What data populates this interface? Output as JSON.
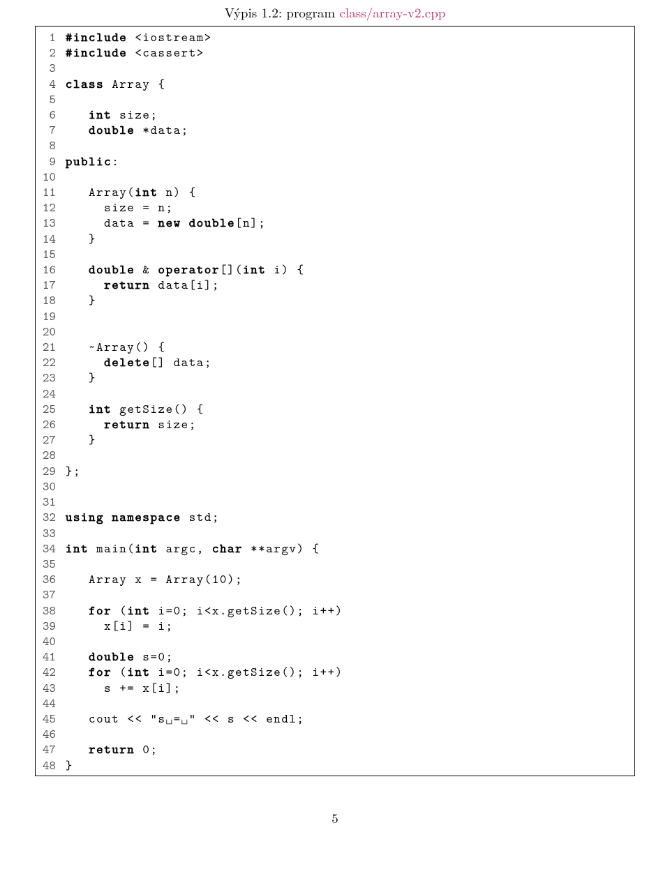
{
  "caption_prefix": "Výpis 1.2: program ",
  "caption_link": "class/array-v2.cpp",
  "page_number": "5",
  "code_lines": [
    [
      {
        "t": "#include",
        "c": "kw"
      },
      {
        "t": " <iostream>"
      }
    ],
    [
      {
        "t": "#include",
        "c": "kw"
      },
      {
        "t": " <cassert>"
      }
    ],
    [],
    [
      {
        "t": "class",
        "c": "kw"
      },
      {
        "t": " Array {"
      }
    ],
    [],
    [
      {
        "t": "   "
      },
      {
        "t": "int",
        "c": "kw"
      },
      {
        "t": " size;"
      }
    ],
    [
      {
        "t": "   "
      },
      {
        "t": "double",
        "c": "kw"
      },
      {
        "t": " *data;"
      }
    ],
    [],
    [
      {
        "t": "public",
        "c": "kw"
      },
      {
        "t": ":"
      }
    ],
    [],
    [
      {
        "t": "   Array("
      },
      {
        "t": "int",
        "c": "kw"
      },
      {
        "t": " n) {"
      }
    ],
    [
      {
        "t": "     size = n;"
      }
    ],
    [
      {
        "t": "     data = "
      },
      {
        "t": "new",
        "c": "kw"
      },
      {
        "t": " "
      },
      {
        "t": "double",
        "c": "kw"
      },
      {
        "t": "[n];"
      }
    ],
    [
      {
        "t": "   }"
      }
    ],
    [],
    [
      {
        "t": "   "
      },
      {
        "t": "double",
        "c": "kw"
      },
      {
        "t": " & "
      },
      {
        "t": "operator",
        "c": "kw"
      },
      {
        "t": "[]("
      },
      {
        "t": "int",
        "c": "kw"
      },
      {
        "t": " i) {"
      }
    ],
    [
      {
        "t": "     "
      },
      {
        "t": "return",
        "c": "kw"
      },
      {
        "t": " data[i];"
      }
    ],
    [
      {
        "t": "   }"
      }
    ],
    [],
    [],
    [
      {
        "t": "   ~Array() {"
      }
    ],
    [
      {
        "t": "     "
      },
      {
        "t": "delete",
        "c": "kw"
      },
      {
        "t": "[] data;"
      }
    ],
    [
      {
        "t": "   }"
      }
    ],
    [],
    [
      {
        "t": "   "
      },
      {
        "t": "int",
        "c": "kw"
      },
      {
        "t": " getSize() {"
      }
    ],
    [
      {
        "t": "     "
      },
      {
        "t": "return",
        "c": "kw"
      },
      {
        "t": " size;"
      }
    ],
    [
      {
        "t": "   }"
      }
    ],
    [],
    [
      {
        "t": "};"
      }
    ],
    [],
    [],
    [
      {
        "t": "using",
        "c": "kw"
      },
      {
        "t": " "
      },
      {
        "t": "namespace",
        "c": "kw"
      },
      {
        "t": " std;"
      }
    ],
    [],
    [
      {
        "t": "int",
        "c": "kw"
      },
      {
        "t": " main("
      },
      {
        "t": "int",
        "c": "kw"
      },
      {
        "t": " argc, "
      },
      {
        "t": "char",
        "c": "kw"
      },
      {
        "t": " **argv) {"
      }
    ],
    [],
    [
      {
        "t": "   Array x = Array(10);"
      }
    ],
    [],
    [
      {
        "t": "   "
      },
      {
        "t": "for",
        "c": "kw"
      },
      {
        "t": " ("
      },
      {
        "t": "int",
        "c": "kw"
      },
      {
        "t": " i=0; i<x.getSize(); i++)"
      }
    ],
    [
      {
        "t": "     x[i] = i;"
      }
    ],
    [],
    [
      {
        "t": "   "
      },
      {
        "t": "double",
        "c": "kw"
      },
      {
        "t": " s=0;"
      }
    ],
    [
      {
        "t": "   "
      },
      {
        "t": "for",
        "c": "kw"
      },
      {
        "t": " ("
      },
      {
        "t": "int",
        "c": "kw"
      },
      {
        "t": " i=0; i<x.getSize(); i++)"
      }
    ],
    [
      {
        "t": "     s += x[i];"
      }
    ],
    [],
    [
      {
        "t": "   cout << "
      },
      {
        "t": "\"s␣=␣\"",
        "c": "str"
      },
      {
        "t": " << s << endl;"
      }
    ],
    [],
    [
      {
        "t": "   "
      },
      {
        "t": "return",
        "c": "kw"
      },
      {
        "t": " 0;"
      }
    ],
    [
      {
        "t": "}"
      }
    ]
  ]
}
